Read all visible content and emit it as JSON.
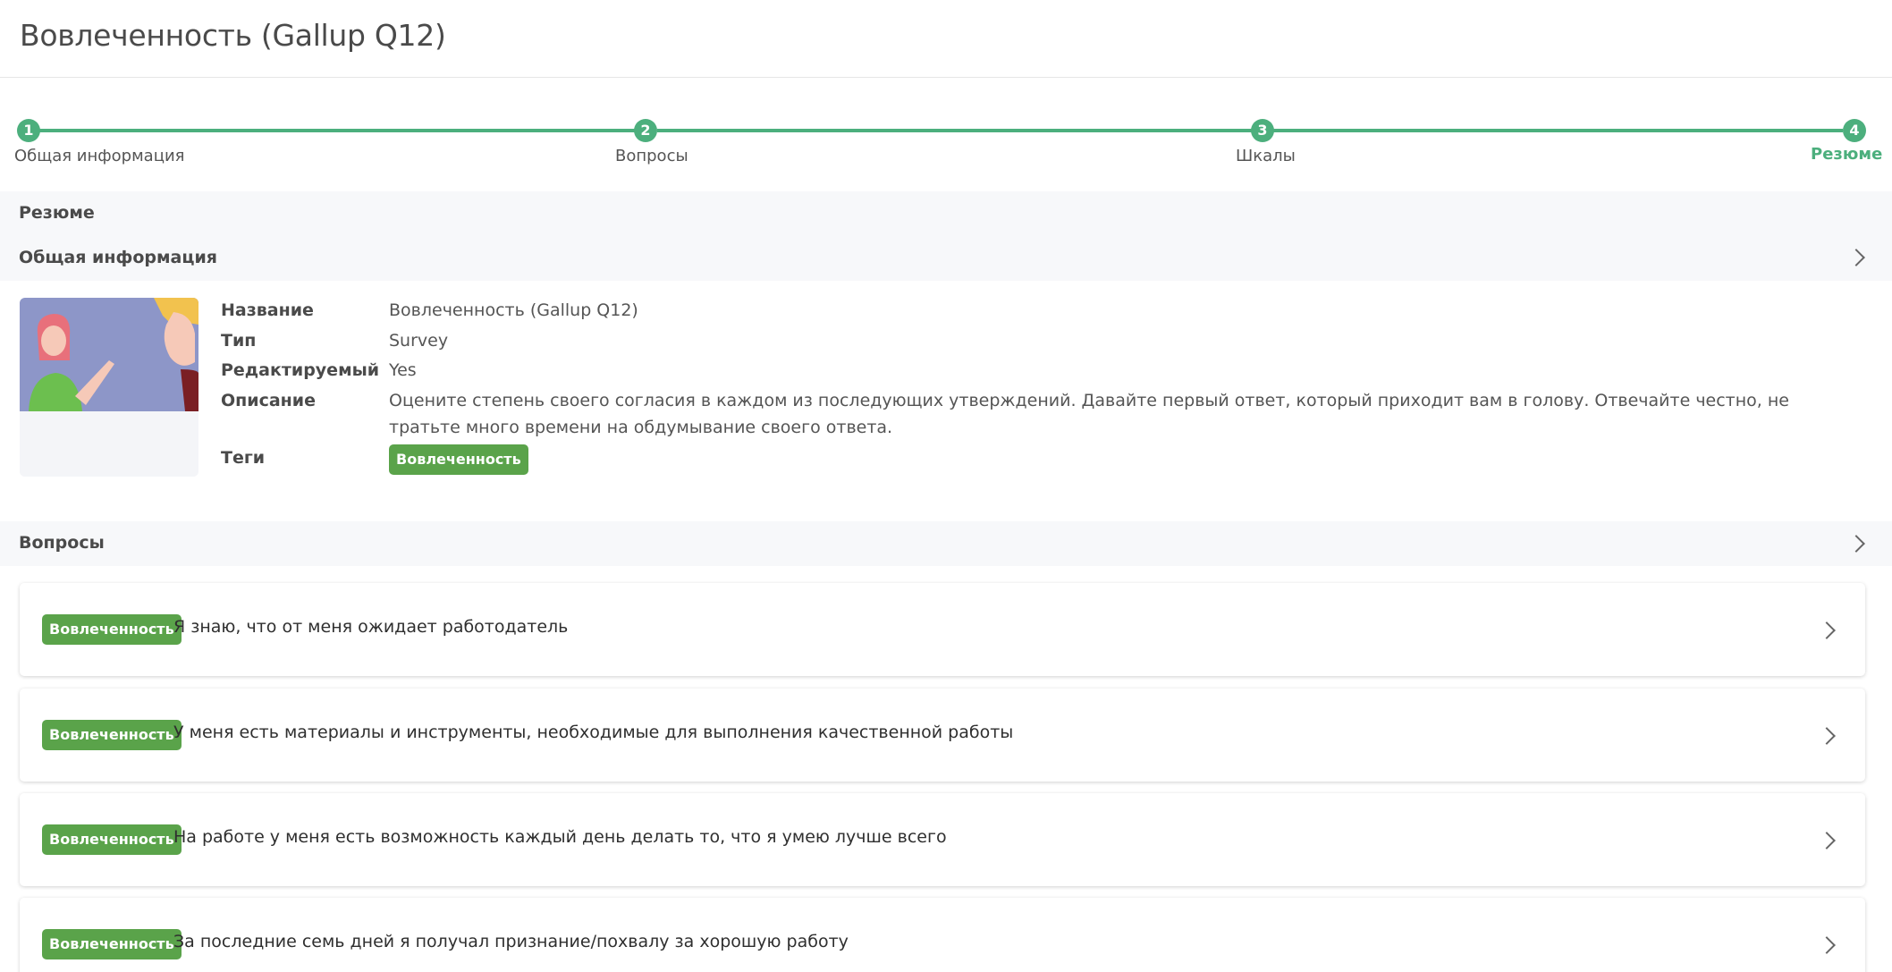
{
  "header": {
    "title": "Вовлеченность (Gallup Q12)"
  },
  "stepper": {
    "steps": [
      {
        "num": "1",
        "label": "Общая информация"
      },
      {
        "num": "2",
        "label": "Вопросы"
      },
      {
        "num": "3",
        "label": "Шкалы"
      },
      {
        "num": "4",
        "label": "Резюме"
      }
    ],
    "active_step": 4
  },
  "summary": {
    "title": "Резюме"
  },
  "general": {
    "title": "Общая информация",
    "fields": {
      "name_label": "Название",
      "name_value": "Вовлеченность (Gallup Q12)",
      "type_label": "Тип",
      "type_value": "Survey",
      "editable_label": "Редактируемый",
      "editable_value": "Yes",
      "description_label": "Описание",
      "description_value_line1": "Оцените степень своего согласия в каждом из последующих утверждений. Давайте первый ответ, который приходит вам в голову. Отвечайте честно, не",
      "description_value_line2": "тратьте много времени на обдумывание своего ответа.",
      "tags_label": "Теги",
      "tag": "Вовлеченность"
    }
  },
  "questions": {
    "title": "Вопросы",
    "items": [
      {
        "tag": "Вовлеченность",
        "text": "Я знаю, что от меня ожидает работодатель"
      },
      {
        "tag": "Вовлеченность",
        "text": "У меня есть материалы и инструменты, необходимые для выполнения качественной работы"
      },
      {
        "tag": "Вовлеченность",
        "text": "На работе у меня есть возможность каждый день делать то, что я умею лучше всего"
      },
      {
        "tag": "Вовлеченность",
        "text": "За последние семь дней я получал признание/похвалу за хорошую работу"
      }
    ]
  },
  "colors": {
    "accent": "#4caf7d",
    "tag": "#5aa34a"
  }
}
